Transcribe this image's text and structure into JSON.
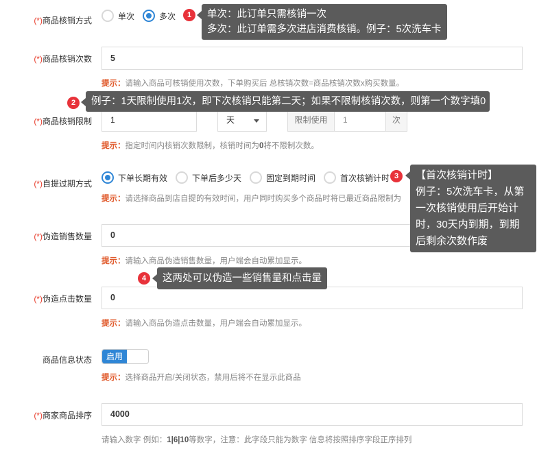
{
  "fields": {
    "verify_mode": {
      "required": "(*)",
      "label": "商品核销方式",
      "options": [
        "单次",
        "多次"
      ],
      "selected": "多次"
    },
    "verify_count": {
      "required": "(*)",
      "label": "商品核销次数",
      "value": "5",
      "hint_key": "提示：",
      "hint": "请输入商品可核销使用次数，下单购买后 总核销次数=商品核销次数x购买数量。"
    },
    "verify_limit": {
      "required": "(*)",
      "label": "商品核销限制",
      "value": "1",
      "unit": "天",
      "limit_label": "限制使用",
      "limit_value": "1",
      "limit_unit": "次",
      "hint_key": "提示：",
      "hint_pre": "指定时间内核销次数限制，核销时间为",
      "hint_zero": "0",
      "hint_post": "将不限制次数。"
    },
    "pickup_expiry": {
      "required": "(*)",
      "label": "自提过期方式",
      "options": [
        "下单长期有效",
        "下单后多少天",
        "固定到期时间",
        "首次核销计时"
      ],
      "selected": "下单长期有效",
      "hint_key": "提示：",
      "hint": "请选择商品到店自提的有效时间，用户同时购买多个商品时将已最近商品限制为"
    },
    "fake_sales": {
      "required": "(*)",
      "label": "伪造销售数量",
      "value": "0",
      "hint_key": "提示：",
      "hint": "请输入商品伪造销售数量，用户端会自动累加显示。"
    },
    "fake_clicks": {
      "required": "(*)",
      "label": "伪造点击数量",
      "value": "0",
      "hint_key": "提示：",
      "hint": "请输入商品伪造点击数量，用户端会自动累加显示。"
    },
    "status": {
      "label": "商品信息状态",
      "toggle_label": "启用",
      "hint_key": "提示：",
      "hint": "选择商品开启/关闭状态，禁用后将不在显示此商品"
    },
    "sort": {
      "required": "(*)",
      "label": "商家商品排序",
      "value": "4000",
      "hint_pre": "请输入数字 例如：",
      "hint_num": "1|6|10",
      "hint_post": "等数字，注意：此字段只能为数字 信息将按照排序字段正序排列"
    }
  },
  "annotations": [
    {
      "num": "1",
      "lines": [
        "单次：此订单只需核销一次",
        "多次：此订单需多次进店消费核销。例子：5次洗车卡"
      ]
    },
    {
      "num": "2",
      "lines": [
        "例子：1天限制使用1次，即下次核销只能第二天；如果不限制核销次数，则第一个数字填0"
      ]
    },
    {
      "num": "3",
      "lines": [
        "【首次核销计时】",
        "例子：5次洗车卡，从第",
        "一次核销使用后开始计",
        "时，30天内到期，到期",
        "后剩余次数作废"
      ]
    },
    {
      "num": "4",
      "lines": [
        "这两处可以伪造一些销售量和点击量"
      ]
    }
  ],
  "colors": {
    "accent": "#2f86d6",
    "required": "#e8402f",
    "hint_key": "#e05a2c",
    "tooltip_bg": "#5b5b5b",
    "badge": "#e8323a"
  }
}
